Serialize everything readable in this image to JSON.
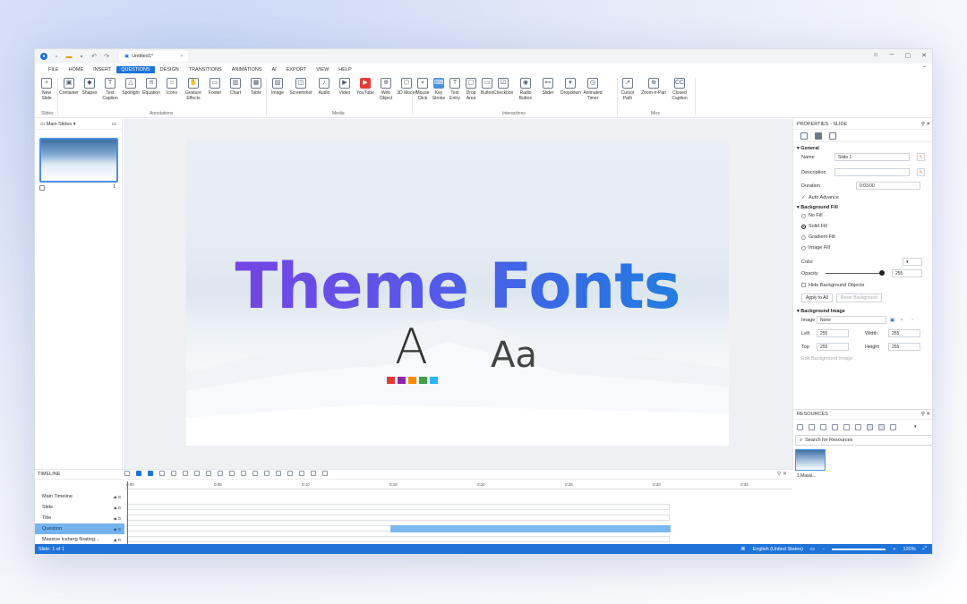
{
  "window": {
    "doc_title": "Untitled1*",
    "close": "×",
    "ctrl_min": "─",
    "ctrl_max": "▢",
    "ctrl_close": "✕"
  },
  "menu": [
    "FILE",
    "HOME",
    "INSERT",
    "QUESTIONS",
    "DESIGN",
    "TRANSITIONS",
    "ANIMATIONS",
    "AI",
    "EXPORT",
    "VIEW",
    "HELP"
  ],
  "menu_active_index": 3,
  "ribbon": {
    "slides": {
      "new_slide": "New Slide",
      "group": "Slides"
    },
    "annotations": [
      "Container",
      "Shapes",
      "Text Caption",
      "Spotlight",
      "Equation",
      "Icons",
      "Gesture Effects",
      "Footer",
      "Chart",
      "Table"
    ],
    "annotations_group": "Annotations",
    "media": [
      "Image",
      "Screenshot",
      "Audio",
      "Video",
      "YouTube",
      "Web Object",
      "3D Model"
    ],
    "media_group": "Media",
    "interactions": [
      "Mouse Click",
      "Key Stroke",
      "Text Entry",
      "Drop Area",
      "Button",
      "Checkbox",
      "Radio Button",
      "Slider",
      "Dropdown",
      "Animated Timer"
    ],
    "interactions_group": "Interactions",
    "misc": [
      "Cursor Path",
      "Zoom-n-Pan",
      "Closed Caption"
    ],
    "misc_group": "Misc"
  },
  "left_panel": {
    "title": "Main Slides",
    "slide_num": "1"
  },
  "slide": {
    "title": "Theme Fonts",
    "glyph_a": "A",
    "glyph_aa": "Aa",
    "swatch_colors": [
      "#e53935",
      "#8e24aa",
      "#fb8c00",
      "#43a047",
      "#29b6f6"
    ]
  },
  "properties": {
    "header": "PROPERTIES - SLIDE",
    "general": "General",
    "name_label": "Name",
    "name_value": "Slide 1",
    "description_label": "Description",
    "duration_label": "Duration",
    "duration_value": "0:03:00",
    "auto_advance": "Auto Advance",
    "background_fill": "Background Fill",
    "fill_options": [
      "No Fill",
      "Solid Fill",
      "Gradient Fill",
      "Image Fill"
    ],
    "fill_selected": 1,
    "color_label": "Color",
    "opacity_label": "Opacity",
    "opacity_value": "255",
    "hide_bg": "Hide Background Objects",
    "apply_all": "Apply to All",
    "reset_bg": "Reset Background",
    "background_image": "Background Image",
    "image_label": "Image",
    "image_value": "None",
    "left_label": "Left",
    "left_value": "255",
    "width_label": "Width",
    "width_value": "255",
    "top_label": "Top",
    "top_value": "255",
    "height_label": "Height",
    "height_value": "255",
    "edit_bg_image": "Edit Background Image"
  },
  "resources": {
    "header": "RESOURCES",
    "search_placeholder": "Search for Resources",
    "item_label": "1.Massi...",
    "tabs": [
      "Images",
      "Audio & Video",
      "Other Resource"
    ]
  },
  "timeline": {
    "header": "TIMELINE",
    "ticks": [
      "0:00",
      "0:05",
      "0:10",
      "0:15",
      "0:20",
      "0:25",
      "0:30",
      "0:35"
    ],
    "rows": [
      "Main Timeline",
      "Slide",
      "Title",
      "Question",
      "Massive iceberg floating..."
    ],
    "selected_row": 3
  },
  "status": {
    "left": "Slide: 1 of 1",
    "language": "English (United States)",
    "zoom": "120%"
  }
}
